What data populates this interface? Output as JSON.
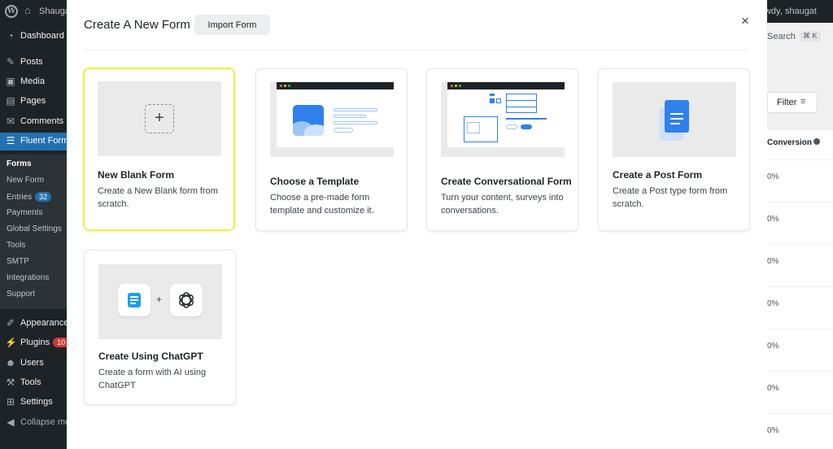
{
  "adminbar": {
    "site_name": "Shaugat",
    "howdy": "Howdy, shaugat"
  },
  "sidebar": {
    "items": [
      {
        "label": "Dashboard",
        "icon": "dashboard-icon"
      },
      {
        "label": "Posts",
        "icon": "pin-icon"
      },
      {
        "label": "Media",
        "icon": "media-icon"
      },
      {
        "label": "Pages",
        "icon": "page-icon"
      },
      {
        "label": "Comments",
        "icon": "comment-icon"
      },
      {
        "label": "Fluent Forms",
        "icon": "fluent-forms-icon"
      }
    ],
    "submenu": [
      {
        "label": "Forms"
      },
      {
        "label": "New Form"
      },
      {
        "label": "Entries",
        "badge": "32"
      },
      {
        "label": "Payments"
      },
      {
        "label": "Global Settings"
      },
      {
        "label": "Tools"
      },
      {
        "label": "SMTP"
      },
      {
        "label": "Integrations"
      },
      {
        "label": "Support"
      }
    ],
    "items2": [
      {
        "label": "Appearance",
        "icon": "brush-icon"
      },
      {
        "label": "Plugins",
        "icon": "plugin-icon",
        "badge": "10"
      },
      {
        "label": "Users",
        "icon": "users-icon"
      },
      {
        "label": "Tools",
        "icon": "wrench-icon"
      },
      {
        "label": "Settings",
        "icon": "settings-icon"
      },
      {
        "label": "Collapse menu",
        "icon": "collapse-icon"
      }
    ]
  },
  "background": {
    "search_label": "Search",
    "search_kbd": "⌘ K",
    "filter_label": "Filter",
    "column_header": "Conversion",
    "cells": [
      "0%",
      "0%",
      "0%",
      "0%",
      "0%",
      "0%",
      "0%"
    ]
  },
  "modal": {
    "title": "Create A New Form",
    "import_label": "Import Form",
    "close_symbol": "×",
    "cards": [
      {
        "title": "New Blank Form",
        "description": "Create a New Blank form from scratch."
      },
      {
        "title": "Choose a Template",
        "description": "Choose a pre-made form template and customize it."
      },
      {
        "title": "Create Conversational Form",
        "description": "Turn your content, surveys into conversations."
      },
      {
        "title": "Create a Post Form",
        "description": "Create a Post type form from scratch."
      },
      {
        "title": "Create Using ChatGPT",
        "description": "Create a form with AI using ChatGPT"
      }
    ]
  },
  "colors": {
    "highlight": "#f5ef3a",
    "accent": "#2271b1",
    "doc_blue": "#2f80ed"
  }
}
